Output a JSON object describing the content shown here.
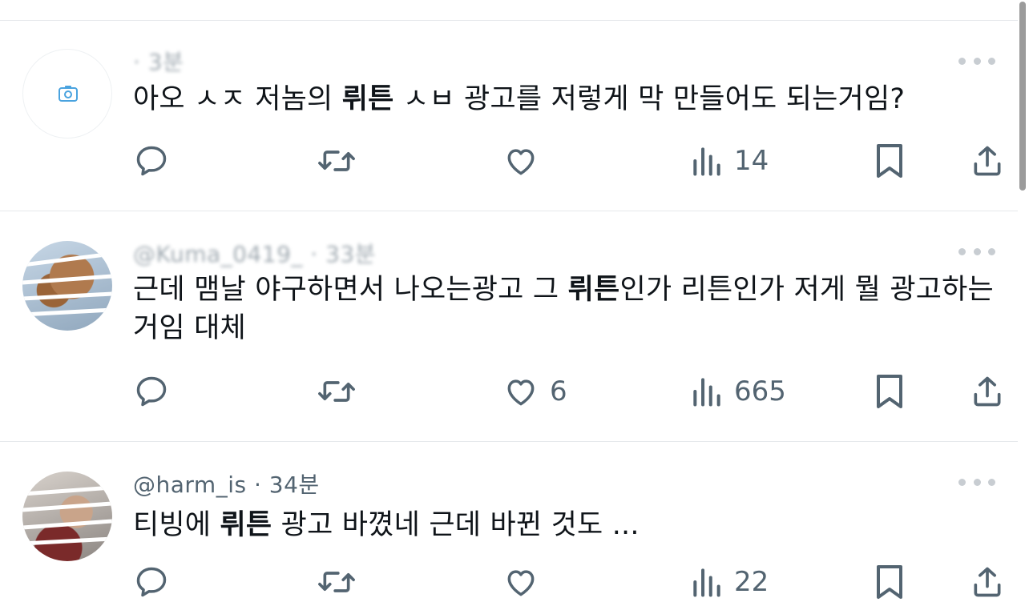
{
  "tweets": [
    {
      "header": "· 3분",
      "avatar": "camera-placeholder",
      "text_parts": [
        {
          "t": "아오 ㅅㅈ 저놈의 ",
          "b": false
        },
        {
          "t": "뤼튼",
          "b": true
        },
        {
          "t": " ㅅㅂ 광고를 저렇게 막 만들어도 되는거임?",
          "b": false
        }
      ],
      "reply_count": "",
      "retweet_count": "",
      "like_count": "",
      "view_count": "14"
    },
    {
      "header": "@Kuma_0419_ · 33분",
      "avatar": "teddy-bear-photo",
      "text_parts": [
        {
          "t": "근데 맴날 야구하면서 나오는광고 그 ",
          "b": false
        },
        {
          "t": "뤼튼",
          "b": true
        },
        {
          "t": "인가 리튼인가 저게 뭘 광고하는 거임 대체",
          "b": false
        }
      ],
      "reply_count": "",
      "retweet_count": "",
      "like_count": "6",
      "view_count": "665"
    },
    {
      "header": "@harm_is · 34분",
      "avatar": "person-photo",
      "text_parts": [
        {
          "t": "티빙에 ",
          "b": false
        },
        {
          "t": "뤼튼",
          "b": true
        },
        {
          "t": " 광고 바꼈네 근데 바뀐 것도 ...",
          "b": false
        }
      ],
      "reply_count": "",
      "retweet_count": "",
      "like_count": "",
      "view_count": "22"
    }
  ],
  "icons": {
    "reply": "reply-icon",
    "retweet": "retweet-icon",
    "like": "heart-icon",
    "views": "views-icon",
    "bookmark": "bookmark-icon",
    "share": "share-icon",
    "more": "more-icon"
  },
  "colors": {
    "text": "#0f1419",
    "secondary": "#536471",
    "divider": "#e6e9ec"
  }
}
